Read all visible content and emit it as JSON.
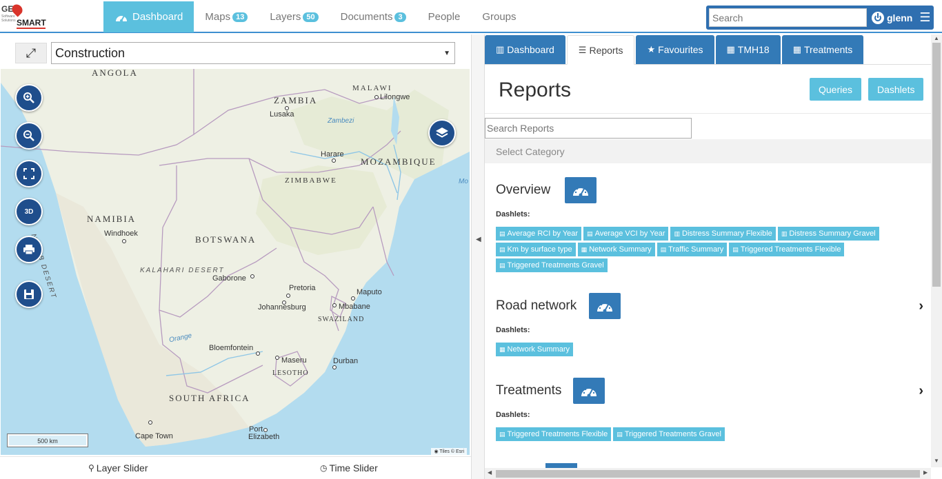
{
  "logo": {
    "top": "GEO",
    "bottom": "SMART",
    "tagline": "Software Solutions"
  },
  "nav": {
    "items": [
      {
        "label": "Dashboard"
      },
      {
        "label": "Maps",
        "badge": "13"
      },
      {
        "label": "Layers",
        "badge": "50"
      },
      {
        "label": "Documents",
        "badge": "3"
      },
      {
        "label": "People"
      },
      {
        "label": "Groups"
      }
    ]
  },
  "search": {
    "placeholder": "Search"
  },
  "user": {
    "name": "glenn"
  },
  "map_panel": {
    "selected_map": "Construction",
    "scale_label": "500 km",
    "attribution": "Tiles © Esri",
    "footer": {
      "layer_slider": "Layer Slider",
      "time_slider": "Time Slider"
    },
    "labels": {
      "angola": "ANGOLA",
      "zambia": "ZAMBIA",
      "malawi": "MALAWI",
      "lilongwe": "Lilongwe",
      "lusaka": "Lusaka",
      "zambezi": "Zambezi",
      "harare": "Harare",
      "mozambique": "MOZAMBIQUE",
      "zimbabwe": "ZIMBABWE",
      "namibia": "NAMIBIA",
      "windhoek": "Windhoek",
      "namib": "NAMIB DESERT",
      "botswana": "BOTSWANA",
      "kalahari": "KALAHARI DESERT",
      "gaborone": "Gaborone",
      "pretoria": "Pretoria",
      "maputo": "Maputo",
      "johannesburg": "Johannesburg",
      "mbabane": "Mbabane",
      "swaziland": "SWAZILAND",
      "orange": "Orange",
      "bloemfontein": "Bloemfontein",
      "maseru": "Maseru",
      "durban": "Durban",
      "lesotho": "LESOTHO",
      "south_africa": "SOUTH AFRICA",
      "cape_town": "Cape Town",
      "port": "Port",
      "elizabeth": "Elizabeth",
      "mo": "Mo"
    }
  },
  "tabs": [
    {
      "label": "Dashboard",
      "icon": "bar-chart-icon"
    },
    {
      "label": "Reports",
      "icon": "list-icon"
    },
    {
      "label": "Favourites",
      "icon": "star-icon"
    },
    {
      "label": "TMH18",
      "icon": "table-icon"
    },
    {
      "label": "Treatments",
      "icon": "table-icon"
    }
  ],
  "reports": {
    "title": "Reports",
    "queries_label": "Queries",
    "dashlets_label": "Dashlets",
    "search_placeholder": "Search Reports",
    "category_label": "Select Category",
    "dashlets_heading": "Dashlets:",
    "sections": [
      {
        "title": "Overview",
        "chips": [
          {
            "label": "Average RCI by Year",
            "icon": "table-icon"
          },
          {
            "label": "Average VCI by Year",
            "icon": "table-icon"
          },
          {
            "label": "Distress Summary Flexible",
            "icon": "bar-chart-icon"
          },
          {
            "label": "Distress Summary Gravel",
            "icon": "bar-chart-icon"
          },
          {
            "label": "Km by surface type",
            "icon": "table-icon"
          },
          {
            "label": "Network Summary",
            "icon": "grid-icon"
          },
          {
            "label": "Traffic Summary",
            "icon": "table-icon"
          },
          {
            "label": "Triggered Treatments Flexible",
            "icon": "table-icon"
          },
          {
            "label": "Triggered Treatments Gravel",
            "icon": "table-icon"
          }
        ]
      },
      {
        "title": "Road network",
        "chips": [
          {
            "label": "Network Summary",
            "icon": "grid-icon"
          }
        ]
      },
      {
        "title": "Treatments",
        "chips": [
          {
            "label": "Triggered Treatments Flexible",
            "icon": "table-icon"
          },
          {
            "label": "Triggered Treatments Gravel",
            "icon": "table-icon"
          }
        ]
      }
    ]
  },
  "colors": {
    "accent": "#5bc0de",
    "primary": "#337ab7",
    "map_button": "#1f4e8c"
  }
}
